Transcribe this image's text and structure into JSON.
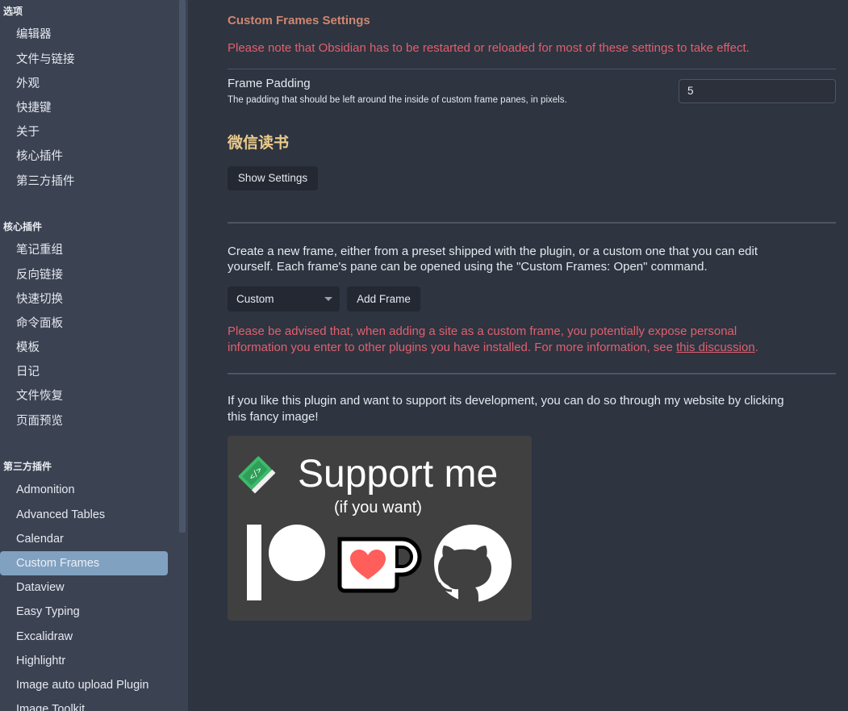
{
  "sidebar": {
    "section_options": "选项",
    "options_items": [
      "编辑器",
      "文件与链接",
      "外观",
      "快捷键",
      "关于",
      "核心插件",
      "第三方插件"
    ],
    "section_core": "核心插件",
    "core_items": [
      "笔记重组",
      "反向链接",
      "快速切换",
      "命令面板",
      "模板",
      "日记",
      "文件恢复",
      "页面预览"
    ],
    "section_third": "第三方插件",
    "third_items": [
      "Admonition",
      "Advanced Tables",
      "Calendar",
      "Custom Frames",
      "Dataview",
      "Easy Typing",
      "Excalidraw",
      "Highlightr",
      "Image auto upload Plugin",
      "Image Toolkit"
    ],
    "active_item": "Custom Frames"
  },
  "main": {
    "section_title": "Custom Frames Settings",
    "restart_note": "Please note that Obsidian has to be restarted or reloaded for most of these settings to take effect.",
    "frame_padding": {
      "name": "Frame Padding",
      "desc": "The padding that should be left around the inside of custom frame panes, in pixels.",
      "value": "5"
    },
    "weread_heading": "微信读书",
    "show_settings_label": "Show Settings",
    "create_line1": "Create a new frame, either from a preset shipped with the plugin, or a custom one that you can edit",
    "create_line2": "yourself. Each frame's pane can be opened using the \"Custom Frames: Open\" command.",
    "preset_selected": "Custom",
    "add_frame_label": "Add Frame",
    "advise_line1": "Please be advised that, when adding a site as a custom frame, you potentially expose personal",
    "advise_line2_prefix": "information you enter to other plugins you have installed. For more information, see ",
    "advise_link": "this discussion",
    "advise_suffix": ".",
    "support_line1": "If you like this plugin and want to support its development, you can do so through my website by clicking",
    "support_line2": "this fancy image!",
    "support_title": "Support me",
    "support_subtitle": "(if you want)"
  },
  "colors": {
    "accent_active": "#81a1c1",
    "heading": "#d08770",
    "warning": "#e0606e",
    "weread_heading": "#ebcb8b"
  }
}
